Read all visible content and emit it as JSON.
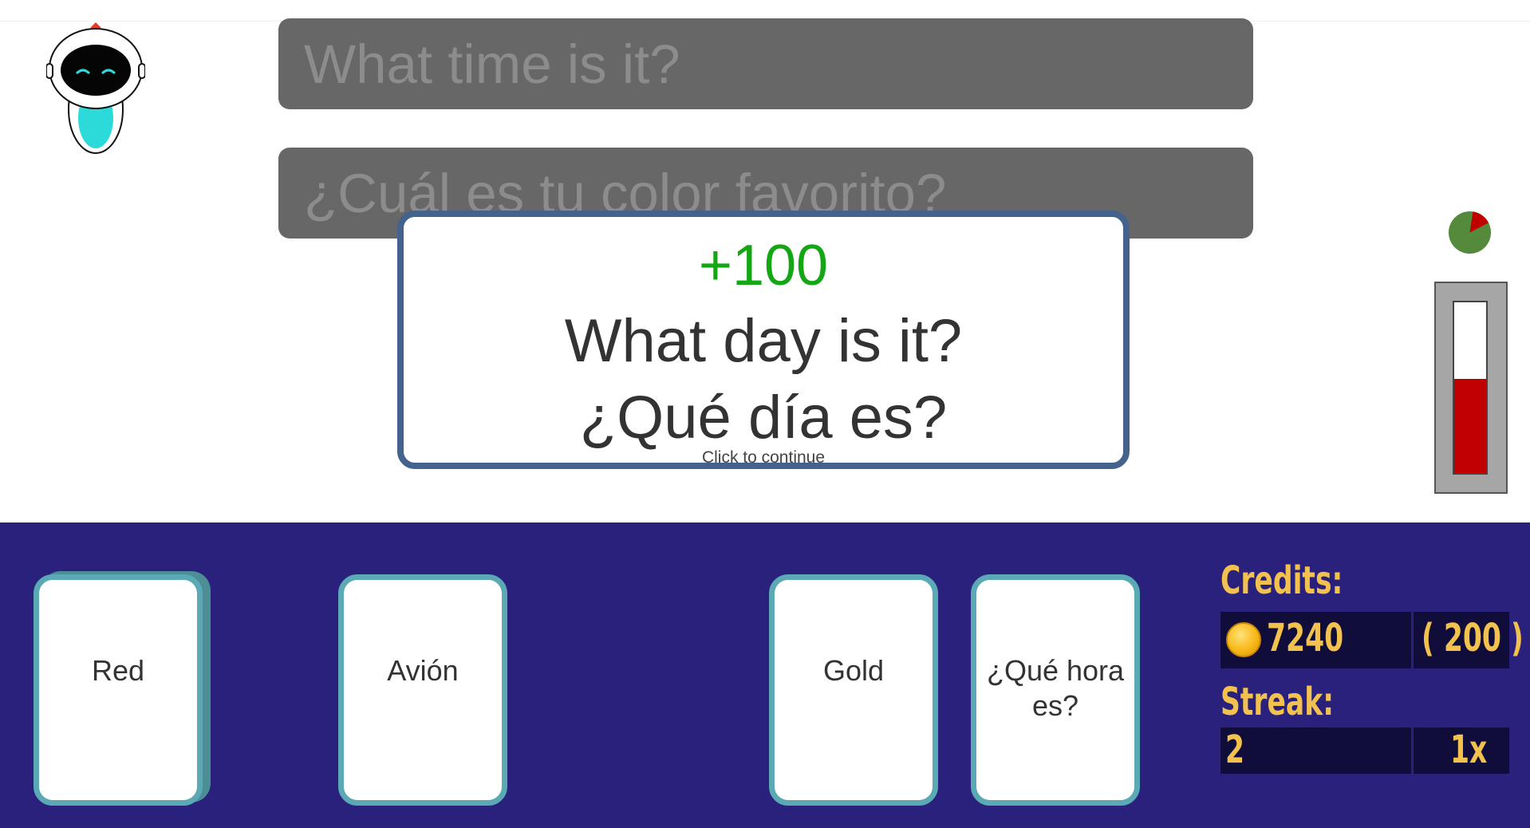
{
  "prompts": {
    "first": "What time is it?",
    "second": "¿Cuál es tu color favorito?"
  },
  "popup": {
    "points": "+100",
    "english": "What day is it?",
    "spanish": "¿Qué día es?",
    "continue_hint": "Click to continue"
  },
  "timer": {
    "elapsed_fraction": 0.15,
    "colors": {
      "remaining": "#558a3c",
      "elapsed": "#c00000"
    }
  },
  "meter": {
    "fill_fraction": 0.55,
    "fill_color": "#c00000"
  },
  "cards": [
    {
      "label": "Red"
    },
    {
      "label": "Avión"
    },
    {
      "label": "Gold"
    },
    {
      "label": "¿Qué hora es?"
    }
  ],
  "stats": {
    "credits_label": "Credits:",
    "credits_value": "7240",
    "credits_bonus": "( 200 )",
    "streak_label": "Streak:",
    "streak_value": "2",
    "multiplier": "1x",
    "coin_icon": "coin-icon"
  },
  "colors": {
    "background": "#ffffff",
    "bottom_panel": "#2a217c",
    "card_border": "#5ba9b5",
    "popup_border": "#43638c",
    "points": "#14a614",
    "stat_text": "#f3c24e",
    "stat_box": "#110d3a",
    "prompt_bg": "#676767"
  }
}
